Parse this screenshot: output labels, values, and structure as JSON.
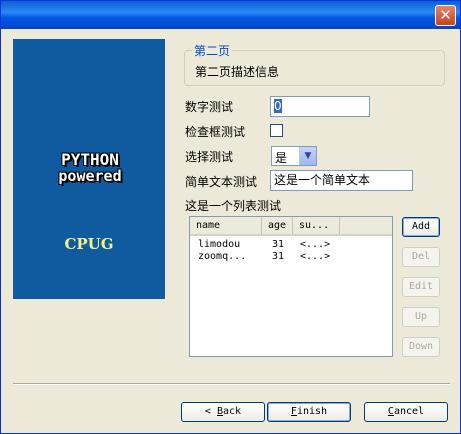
{
  "title_bar": {
    "close_icon": "close-icon",
    "close_glyph": "✕"
  },
  "banner": {
    "logo_line1": "PYTHON",
    "logo_line2": "powered",
    "caption": "CPUG",
    "bg_color": "#105aa0",
    "caption_color": "#f4f28a"
  },
  "page": {
    "group_title": "第二页",
    "group_desc": "第二页描述信息"
  },
  "form": {
    "number_label": "数字测试",
    "number_value": "0",
    "checkbox_label": "检查框测试",
    "select_label": "选择测试",
    "select_value": "是",
    "text_label": "简单文本测试",
    "text_value": "这是一个简单文本",
    "list_label": "这是一个列表测试"
  },
  "list": {
    "columns": [
      "name",
      "age",
      "su..."
    ],
    "rows": [
      {
        "name": "limodou",
        "age": "31",
        "su": "<...>"
      },
      {
        "name": "zoomq...",
        "age": "31",
        "su": "<...>"
      }
    ]
  },
  "side_buttons": {
    "add": "Add",
    "del": "Del",
    "edit": "Edit",
    "up": "Up",
    "down": "Down"
  },
  "footer": {
    "back_arrow": "<",
    "back_b": "B",
    "back_rest": "ack",
    "finish_f": "F",
    "finish_rest": "inish",
    "cancel_c": "C",
    "cancel_rest": "ancel"
  }
}
